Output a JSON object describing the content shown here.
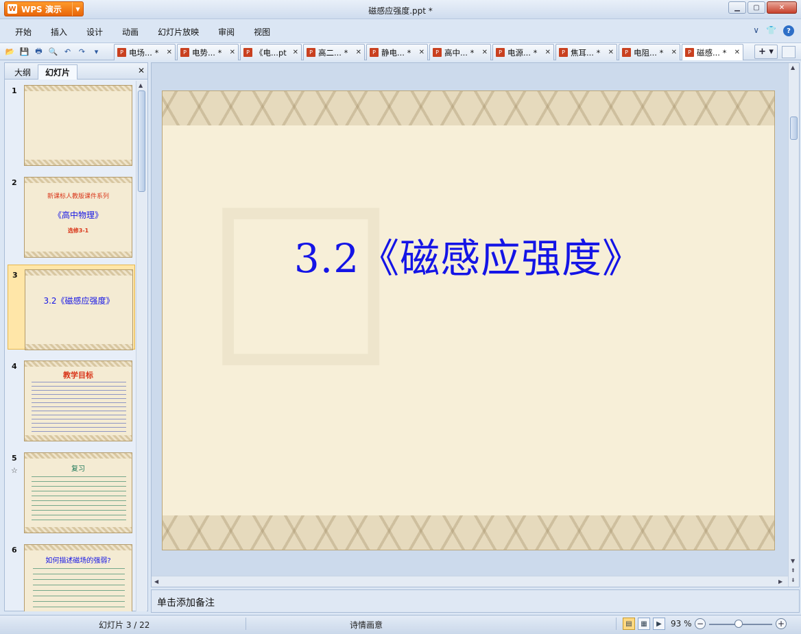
{
  "app": {
    "button_label": "WPS 演示",
    "logo_glyph": "W",
    "window_title": "磁感应强度.ppt *"
  },
  "menu": [
    "开始",
    "插入",
    "设计",
    "动画",
    "幻灯片放映",
    "审阅",
    "视图"
  ],
  "doc_tabs": [
    {
      "label": "电场... *"
    },
    {
      "label": "电势... *"
    },
    {
      "label": "《电...pt"
    },
    {
      "label": "高二... *"
    },
    {
      "label": "静电... *"
    },
    {
      "label": "高中... *"
    },
    {
      "label": "电源... *"
    },
    {
      "label": "焦耳... *"
    },
    {
      "label": "电阻... *"
    },
    {
      "label": "磁感... *"
    }
  ],
  "left_pane": {
    "tabs": [
      "大纲",
      "幻灯片"
    ],
    "thumbnails": [
      {
        "num": "1"
      },
      {
        "num": "2",
        "lines": [
          "新课标人教版课件系列",
          "《高中物理》",
          "选修3-1"
        ]
      },
      {
        "num": "3",
        "lines": [
          "3.2《磁感应强度》"
        ]
      },
      {
        "num": "4",
        "lines": [
          "教学目标"
        ]
      },
      {
        "num": "5",
        "lines": [
          "复习"
        ],
        "star": "☆"
      },
      {
        "num": "6",
        "lines": [
          "如何描述磁场的强弱?"
        ]
      }
    ]
  },
  "slide": {
    "title": "3.2《磁感应强度》"
  },
  "notes": {
    "placeholder": "单击添加备注"
  },
  "status": {
    "slide_info": "幻灯片 3 / 22",
    "theme": "诗情画意",
    "zoom": "93 %"
  },
  "colors": {
    "slide_title": "#1414e6",
    "thumb_red": "#d9361a",
    "thumb_teal": "#1f7a5a"
  }
}
